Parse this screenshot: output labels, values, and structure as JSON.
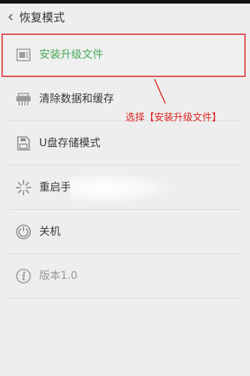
{
  "header": {
    "title": "恢复模式",
    "back_icon": "chevron-left-icon"
  },
  "menu": {
    "items": [
      {
        "label": "安装升级文件",
        "icon": "package-install-icon",
        "state": "selected"
      },
      {
        "label": "清除数据和缓存",
        "icon": "clear-data-icon",
        "state": "normal"
      },
      {
        "label": "U盘存储模式",
        "icon": "usb-storage-icon",
        "state": "normal"
      },
      {
        "label": "重启手",
        "icon": "restart-spinner-icon",
        "state": "normal"
      },
      {
        "label": "关机",
        "icon": "power-icon",
        "state": "normal"
      },
      {
        "label": "版本1.0",
        "icon": "info-icon",
        "state": "disabled"
      }
    ]
  },
  "annotation": {
    "text": "选择【安装升级文件】",
    "color": "#e02424"
  },
  "colors": {
    "accent": "#2a9a3c",
    "highlight": "#e05050"
  }
}
